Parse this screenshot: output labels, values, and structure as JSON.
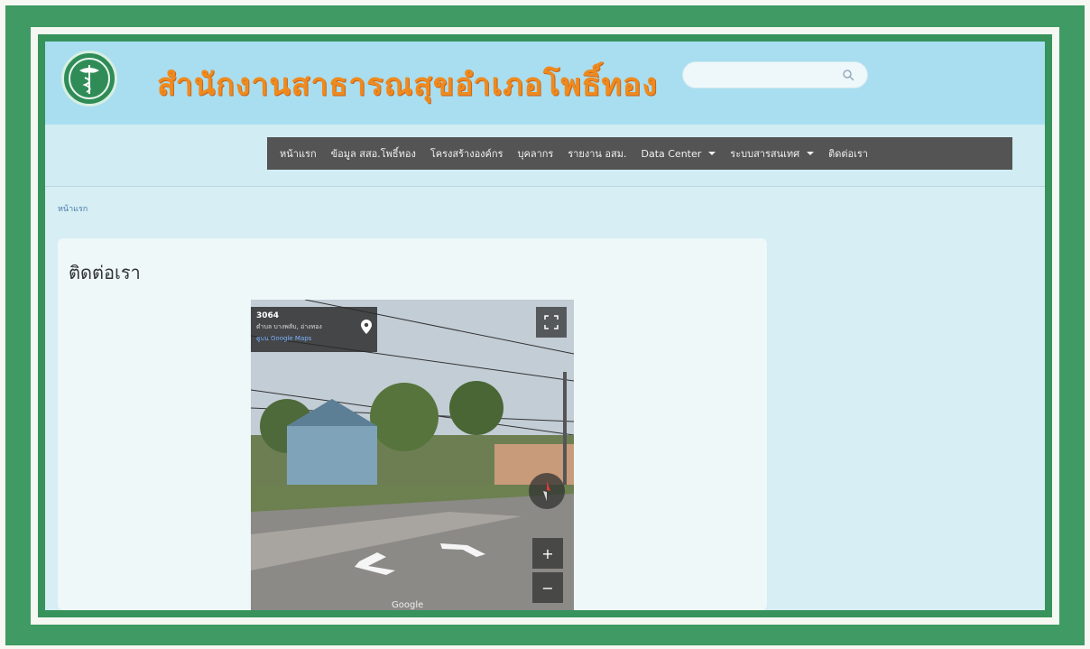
{
  "header": {
    "title": "สำนักงานสาธารณสุขอำเภอโพธิ์ทอง",
    "logo_icon": "ministry-of-public-health-logo",
    "search": {
      "placeholder": ""
    }
  },
  "nav": {
    "items": [
      {
        "label": "หน้าแรก",
        "dropdown": false
      },
      {
        "label": "ข้อมูล สสอ.โพธิ์ทอง",
        "dropdown": false
      },
      {
        "label": "โครงสร้างองค์กร",
        "dropdown": false
      },
      {
        "label": "บุคลากร",
        "dropdown": false
      },
      {
        "label": "รายงาน อสม.",
        "dropdown": false
      },
      {
        "label": "Data Center",
        "dropdown": true
      },
      {
        "label": "ระบบสารสนเทศ",
        "dropdown": true
      },
      {
        "label": "ติดต่อเรา",
        "dropdown": false
      }
    ]
  },
  "breadcrumb": {
    "home": "หน้าแรก"
  },
  "main": {
    "title": "ติดต่อเรา",
    "map": {
      "place_title": "3064",
      "place_address": "ตำบล บางพลับ, อ่างทอง",
      "place_link": "ดูบน Google Maps",
      "attribution": "Google",
      "zoom_in": "+",
      "zoom_out": "−"
    }
  },
  "colors": {
    "frame": "#3f9a63",
    "header_bg": "#a8def0",
    "title": "#ef8a1e",
    "navbar_bg": "#545454"
  }
}
